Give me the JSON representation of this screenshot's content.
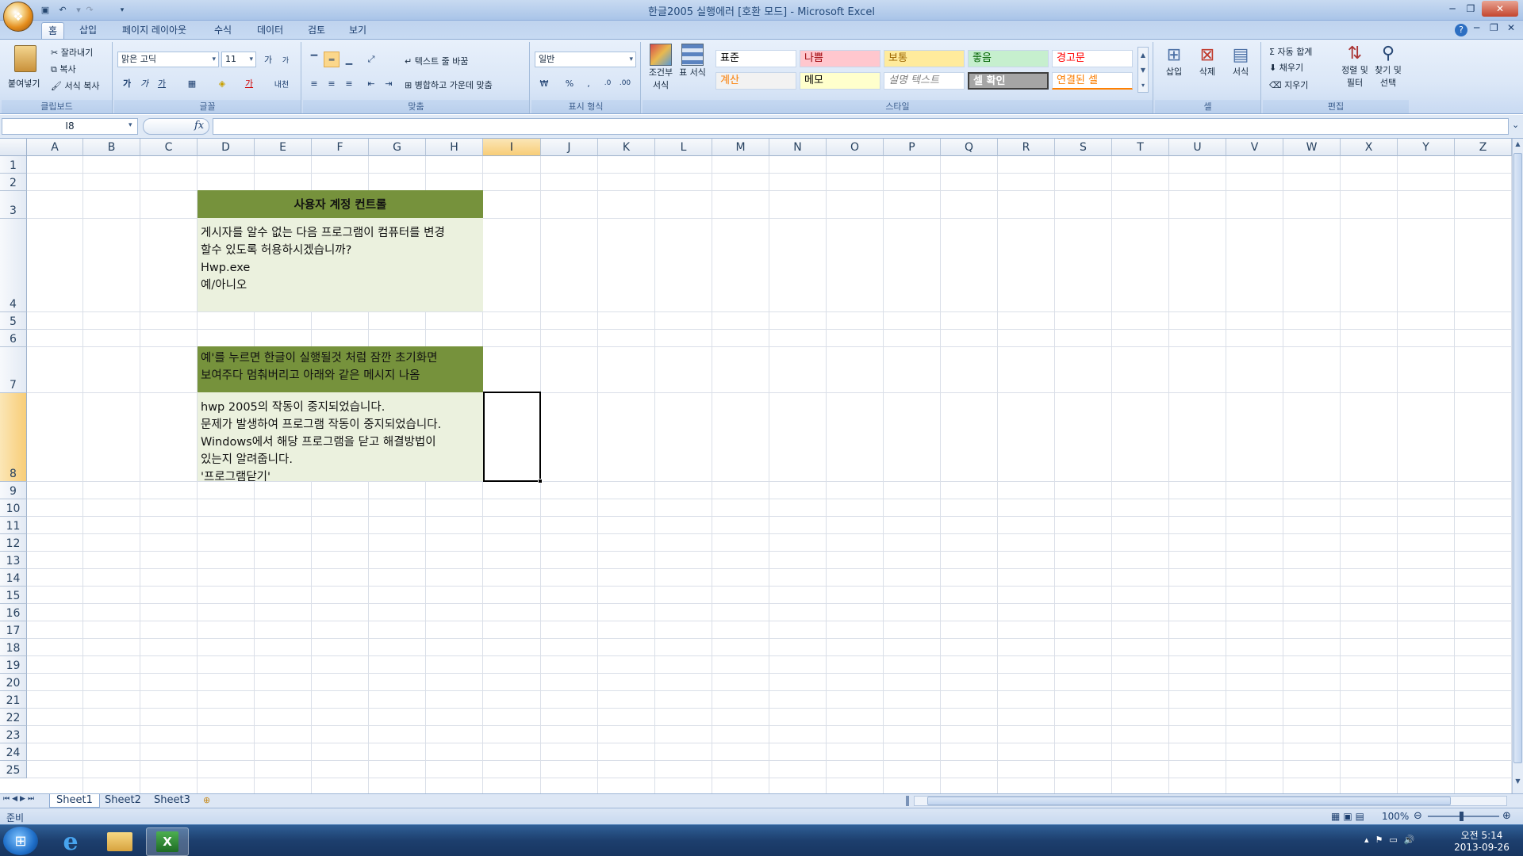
{
  "window": {
    "title": "한글2005 실행에러  [호환 모드] - Microsoft Excel"
  },
  "tabs": [
    {
      "label": "홈"
    },
    {
      "label": "삽입"
    },
    {
      "label": "페이지 레이아웃"
    },
    {
      "label": "수식"
    },
    {
      "label": "데이터"
    },
    {
      "label": "검토"
    },
    {
      "label": "보기"
    }
  ],
  "clipboard": {
    "paste": "붙여넣기",
    "cut": "잘라내기",
    "copy": "복사",
    "format_painter": "서식 복사",
    "label": "클립보드"
  },
  "font": {
    "name": "맑은 고딕",
    "size": "11",
    "bold": "가",
    "italic": "가",
    "underline": "가",
    "label": "글꼴",
    "grow": "가",
    "shrink": "가",
    "phonetic": "내천"
  },
  "alignment": {
    "wrap": "텍스트 줄 바꿈",
    "merge": "병합하고 가운데 맞춤",
    "label": "맞춤"
  },
  "number": {
    "format": "일반",
    "label": "표시 형식"
  },
  "styles": {
    "label": "스타일",
    "conditional": "조건부 서식",
    "table": "표 서식",
    "items": [
      {
        "label": "표준",
        "bg": "#ffffff",
        "color": "#000000"
      },
      {
        "label": "나쁨",
        "bg": "#ffc7ce",
        "color": "#9c0006"
      },
      {
        "label": "보통",
        "bg": "#ffeb9c",
        "color": "#9c6500"
      },
      {
        "label": "좋음",
        "bg": "#c6efce",
        "color": "#006100"
      },
      {
        "label": "경고문",
        "bg": "#ffffff",
        "color": "#ff0000"
      },
      {
        "label": "계산",
        "bg": "#f2f2f2",
        "color": "#fa7d00"
      },
      {
        "label": "메모",
        "bg": "#ffffcc",
        "color": "#000000"
      },
      {
        "label": "설명 텍스트",
        "bg": "#ffffff",
        "color": "#7f7f7f"
      },
      {
        "label": "셀 확인",
        "bg": "#a5a5a5",
        "color": "#ffffff"
      },
      {
        "label": "연결된 셀",
        "bg": "#ffffff",
        "color": "#fa7d00"
      }
    ]
  },
  "cells_group": {
    "insert": "삽입",
    "delete": "삭제",
    "format": "서식",
    "label": "셀"
  },
  "editing": {
    "autosum": "자동 합계",
    "fill": "채우기",
    "clear": "지우기",
    "sort": "정렬 및 필터",
    "find": "찾기 및 선택",
    "label": "편집"
  },
  "formula_bar": {
    "name_box": "I8",
    "fx": "fx",
    "value": ""
  },
  "columns": [
    "A",
    "B",
    "C",
    "D",
    "E",
    "F",
    "G",
    "H",
    "I",
    "J",
    "K",
    "L",
    "M",
    "N",
    "O",
    "P",
    "Q",
    "R",
    "S",
    "T",
    "U",
    "V",
    "W",
    "X",
    "Y",
    "Z"
  ],
  "rows": [
    "1",
    "2",
    "3",
    "4",
    "5",
    "6",
    "7",
    "8",
    "9",
    "10",
    "11",
    "12",
    "13",
    "14",
    "15",
    "16",
    "17",
    "18",
    "19",
    "20",
    "21",
    "22",
    "23",
    "24",
    "25"
  ],
  "sheet": {
    "title_cell": "사용자 계정 컨트롤",
    "prompt_cell": "게시자를 알수 없는 다음 프로그램이 컴퓨터를 변경\n할수 있도록 허용하시겠습니까?\nHwp.exe\n예/아니오",
    "note_cell": "예'를 누르면 한글이 실행될것 처럼 잠깐 초기화면\n보여주다 멈춰버리고 아래와 같은 메시지 나옴",
    "error_cell": "hwp 2005의 작동이 중지되었습니다.\n문제가 발생하여 프로그램 작동이 중지되었습니다.\nWindows에서 해당 프로그램을 닫고 해결방법이\n있는지 알려줍니다.\n'프로그램닫기'",
    "header_color": "#76923c",
    "body_color": "#ebf1de"
  },
  "sheet_tabs": [
    {
      "label": "Sheet1"
    },
    {
      "label": "Sheet2"
    },
    {
      "label": "Sheet3"
    }
  ],
  "status": {
    "text": "준비",
    "zoom": "100%"
  },
  "taskbar": {
    "time": "오전 5:14",
    "date": "2013-09-26"
  }
}
